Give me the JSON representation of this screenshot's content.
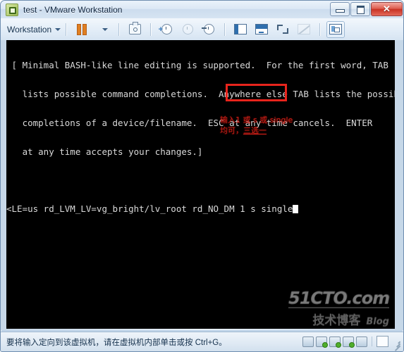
{
  "window": {
    "title": "test - VMware Workstation",
    "app_icon": "vmware-icon",
    "controls": {
      "minimize": "minimize-icon",
      "maximize": "maximize-icon",
      "close": "✕"
    }
  },
  "toolbar": {
    "menu_label": "Workstation",
    "buttons": [
      {
        "name": "pause-vm-button",
        "icon": "pause-icon",
        "enabled": true
      },
      {
        "name": "pause-dropdown-button",
        "icon": "chevron-down-icon",
        "enabled": true
      },
      {
        "name": "snapshot-manager-button",
        "icon": "snapshot-icon",
        "enabled": true
      },
      {
        "name": "take-snapshot-button",
        "icon": "clock-plus-icon",
        "enabled": true
      },
      {
        "name": "revert-snapshot-button",
        "icon": "clock-icon",
        "enabled": false
      },
      {
        "name": "manage-snapshots-button",
        "icon": "clock-back-icon",
        "enabled": true
      },
      {
        "name": "show-sidebar-button",
        "icon": "panel-left-icon",
        "enabled": true
      },
      {
        "name": "show-console-view-button",
        "icon": "screen-icon",
        "enabled": true
      },
      {
        "name": "fullscreen-button",
        "icon": "fullscreen-icon",
        "enabled": true
      },
      {
        "name": "unity-mode-button",
        "icon": "unity-icon",
        "enabled": false
      },
      {
        "name": "console-layout-button",
        "icon": "console-icon",
        "enabled": true,
        "active": true
      }
    ]
  },
  "vm_screen": {
    "terminal_lines": [
      " [ Minimal BASH-like line editing is supported.  For the first word, TAB",
      "   lists possible command completions.  Anywhere else TAB lists the possible",
      "   completions of a device/filename.  ESC at any time cancels.  ENTER",
      "   at any time accepts your changes.]",
      ""
    ],
    "command_prompt": "<LE=us rd_LVM_LV=vg_bright/lv_root rd_NO_DM ",
    "command_typed": "1 s single",
    "cursor": "block-cursor",
    "highlight_color": "#e8241c",
    "annotation": {
      "line1": "输入1 或 s 或 single",
      "line2_prefix": "均可，",
      "line2_underlined": "三选一",
      "color": "#d02018"
    },
    "watermark": {
      "main": "51CTO.com",
      "sub_cn": "技术博客",
      "sub_en": "Blog"
    }
  },
  "status_bar": {
    "message": "要将输入定向到该虚拟机，请在虚拟机内部单击或按 Ctrl+G。",
    "devices": [
      {
        "name": "status-hard-disk-icon"
      },
      {
        "name": "status-cd-dvd-icon"
      },
      {
        "name": "status-floppy-icon"
      },
      {
        "name": "status-network-icon"
      },
      {
        "name": "status-usb-icon"
      }
    ],
    "extra_icon": "status-blank-icon",
    "grip": "resize-grip-icon"
  }
}
